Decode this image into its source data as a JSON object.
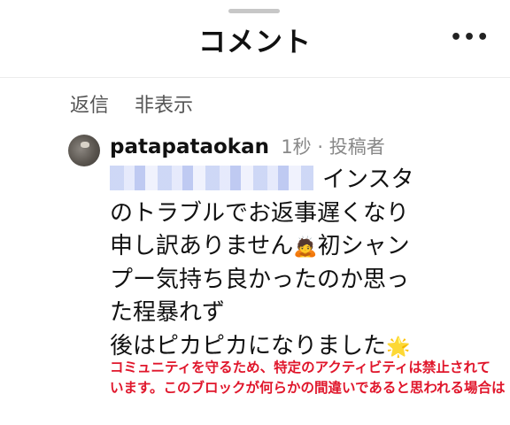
{
  "header": {
    "title": "コメント",
    "more_label": "•••"
  },
  "actions": {
    "reply": "返信",
    "hide": "非表示"
  },
  "comment": {
    "username": "patapataokan",
    "meta": "1秒 · 投稿者",
    "lines": [
      "インスタ",
      "のトラブルでお返事遅くなり",
      "申し訳ありません",
      "初シャン",
      "プー気持ち良かったのか思っ",
      "た程暴れず",
      "後はピカピカになりました"
    ],
    "emoji_bow": "🙇",
    "emoji_star": "🌟"
  },
  "warning": {
    "line1": "コミュニティを守るため、特定のアクティビティは禁止されて",
    "line2": "います。このブロックが何らかの間違いであると思われる場合は"
  }
}
